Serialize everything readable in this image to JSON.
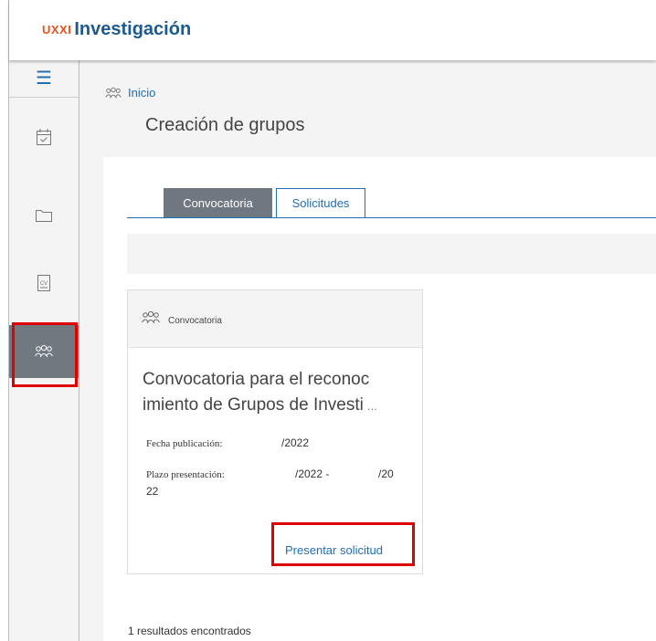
{
  "header": {
    "brand_prefix": "UXXI",
    "brand_name": "Investigación"
  },
  "sidebar": {
    "items": [
      {
        "icon": "hamburger-menu-icon"
      },
      {
        "icon": "calendar-check-icon"
      },
      {
        "icon": "folder-icon"
      },
      {
        "icon": "cv-document-icon"
      },
      {
        "icon": "groups-icon",
        "active": true
      }
    ]
  },
  "breadcrumb": {
    "icon": "groups-icon",
    "label": "Inicio"
  },
  "page": {
    "title": "Creación de grupos"
  },
  "tabs": [
    {
      "label": "Convocatoria",
      "active": true
    },
    {
      "label": "Solicitudes",
      "active": false
    }
  ],
  "card": {
    "header_label": "Convocatoria",
    "title": "Convocatoria para el reconoc imiento de Grupos de Investi",
    "title_ellipsis": "...",
    "fecha_label": "Fecha publicación:",
    "fecha_value": "/2022",
    "plazo_label": "Plazo presentación:",
    "plazo_value_1": "/2022 -",
    "plazo_value_2": "/20",
    "plazo_value_3": "22",
    "action_label": "Presentar solicitud"
  },
  "results": {
    "text": "1 resultados encontrados"
  },
  "colors": {
    "accent": "#1f6fb5",
    "brand_orange": "#e8541c",
    "brand_blue": "#1d5a8e",
    "active_tab": "#6f7780",
    "highlight": "#e00000"
  }
}
